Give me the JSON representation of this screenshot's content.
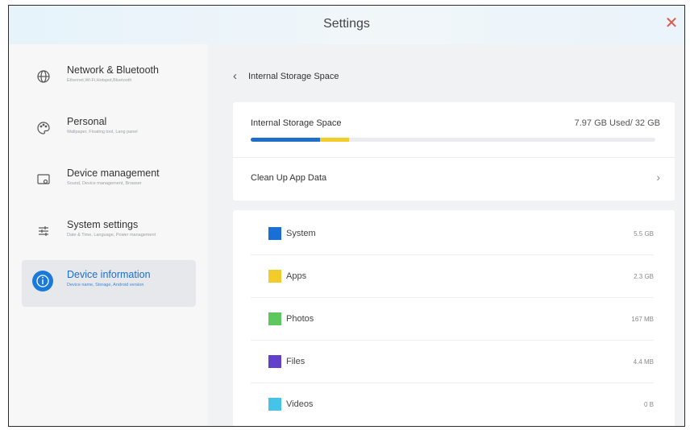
{
  "window": {
    "title": "Settings",
    "close_icon": "close-icon"
  },
  "sidebar": {
    "items": [
      {
        "label": "Network & Bluetooth",
        "sub": "Ethernet,Wi-Fi,Hotspot,Bluetooth",
        "icon": "globe-icon"
      },
      {
        "label": "Personal",
        "sub": "Wallpaper, Floating tool, Lang panel",
        "icon": "palette-icon"
      },
      {
        "label": "Device management",
        "sub": "Sound, Device management, Browser",
        "icon": "device-icon"
      },
      {
        "label": "System settings",
        "sub": "Date & Time, Language, Power management",
        "icon": "sliders-icon"
      },
      {
        "label": "Device information",
        "sub": "Device name, Storage, Android version",
        "icon": "info-icon",
        "active": true
      }
    ]
  },
  "main": {
    "breadcrumb": {
      "back_icon": "back-chevron-icon",
      "label": "Internal Storage Space"
    },
    "storage": {
      "label": "Internal Storage Space",
      "value": "7.97 GB Used/ 32 GB",
      "segments": [
        {
          "name": "System",
          "fraction": 0.172,
          "color": "#1e6fc8"
        },
        {
          "name": "Apps",
          "fraction": 0.072,
          "color": "#f2cc2a"
        }
      ]
    },
    "cleanup": {
      "label": "Clean Up App Data",
      "chevron_icon": "chevron-right-icon"
    },
    "categories": [
      {
        "name": "System",
        "size": "5.5 GB",
        "color": "#1a6fd6"
      },
      {
        "name": "Apps",
        "size": "2.3 GB",
        "color": "#f2cc2a"
      },
      {
        "name": "Photos",
        "size": "167 MB",
        "color": "#5cc85f"
      },
      {
        "name": "Files",
        "size": "4.4 MB",
        "color": "#6340c9"
      },
      {
        "name": "Videos",
        "size": "0 B",
        "color": "#45c4e8"
      }
    ]
  }
}
